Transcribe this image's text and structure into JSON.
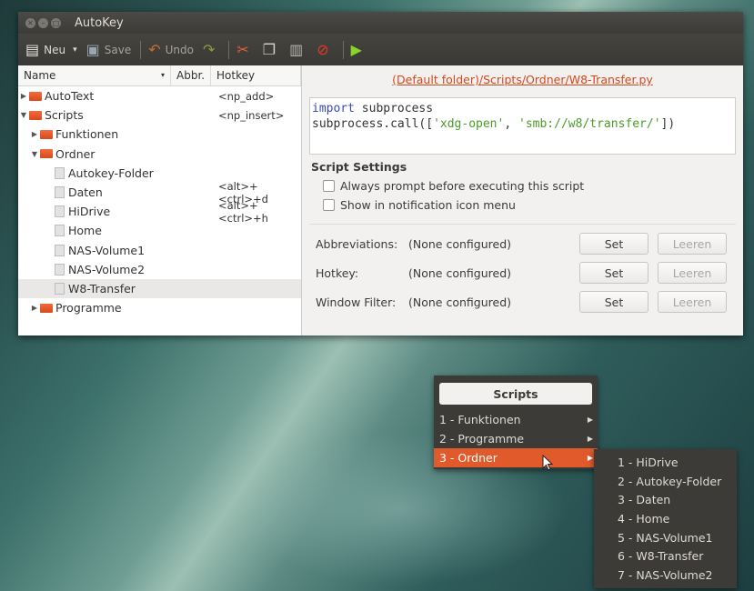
{
  "window": {
    "title": "AutoKey"
  },
  "toolbar": {
    "new_label": "Neu",
    "save_label": "Save",
    "undo_label": "Undo"
  },
  "tree": {
    "columns": [
      "Name",
      "Abbr.",
      "Hotkey"
    ],
    "rows": [
      {
        "label": "AutoText",
        "hotkey": "<np_add>",
        "type": "folder",
        "expanded": false,
        "indent": 0
      },
      {
        "label": "Scripts",
        "hotkey": "<np_insert>",
        "type": "folder",
        "expanded": true,
        "indent": 0
      },
      {
        "label": "Funktionen",
        "hotkey": "",
        "type": "folder",
        "expanded": false,
        "indent": 1
      },
      {
        "label": "Ordner",
        "hotkey": "",
        "type": "folder",
        "expanded": true,
        "indent": 1
      },
      {
        "label": "Autokey-Folder",
        "hotkey": "",
        "type": "script",
        "indent": 2
      },
      {
        "label": "Daten",
        "hotkey": "<alt>+<ctrl>+d",
        "type": "script",
        "indent": 2
      },
      {
        "label": "HiDrive",
        "hotkey": "<alt>+<ctrl>+h",
        "type": "script",
        "indent": 2
      },
      {
        "label": "Home",
        "hotkey": "",
        "type": "script",
        "indent": 2
      },
      {
        "label": "NAS-Volume1",
        "hotkey": "",
        "type": "script",
        "indent": 2
      },
      {
        "label": "NAS-Volume2",
        "hotkey": "",
        "type": "script",
        "indent": 2
      },
      {
        "label": "W8-Transfer",
        "hotkey": "",
        "type": "script",
        "indent": 2,
        "selected": true
      },
      {
        "label": "Programme",
        "hotkey": "",
        "type": "folder",
        "expanded": false,
        "indent": 1
      }
    ]
  },
  "editor": {
    "path": "(Default folder)/Scripts/Ordner/W8-Transfer.py",
    "code_line1_kw": "import",
    "code_line1_rest": " subprocess",
    "code_line2_pre": "subprocess.call([",
    "code_line2_s1": "'xdg-open'",
    "code_line2_mid": ", ",
    "code_line2_s2": "'smb://w8/transfer/'",
    "code_line2_post": "])"
  },
  "settings": {
    "heading": "Script Settings",
    "checkbox1": "Always prompt before executing this script",
    "checkbox2": "Show in notification icon menu",
    "rows": [
      {
        "label": "Abbreviations:",
        "value": "(None configured)",
        "set": "Set",
        "clear": "Leeren"
      },
      {
        "label": "Hotkey:",
        "value": "(None configured)",
        "set": "Set",
        "clear": "Leeren"
      },
      {
        "label": "Window Filter:",
        "value": "(None configured)",
        "set": "Set",
        "clear": "Leeren"
      }
    ]
  },
  "popup_menu": {
    "title": "Scripts",
    "items": [
      {
        "label": "1 - Funktionen",
        "active": false
      },
      {
        "label": "2 - Programme",
        "active": false
      },
      {
        "label": "3 - Ordner",
        "active": true
      }
    ],
    "submenu": [
      "1 - HiDrive",
      "2 - Autokey-Folder",
      "3 - Daten",
      "4 - Home",
      "5 - NAS-Volume1",
      "6 - W8-Transfer",
      "7 - NAS-Volume2"
    ]
  },
  "colors": {
    "accent": "#e05a2b",
    "menu_bg": "#3c3b37",
    "folder": "#e8562a"
  }
}
